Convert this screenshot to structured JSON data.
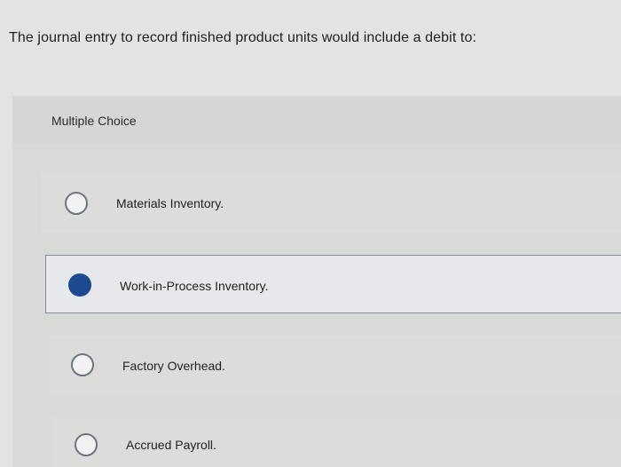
{
  "question": {
    "text": "The journal entry to record finished product units would include a debit to:"
  },
  "multiple_choice": {
    "label": "Multiple Choice",
    "options": [
      {
        "label": "Materials Inventory.",
        "selected": false
      },
      {
        "label": "Work-in-Process Inventory.",
        "selected": true
      },
      {
        "label": "Factory Overhead.",
        "selected": false
      },
      {
        "label": "Accrued Payroll.",
        "selected": false
      }
    ]
  },
  "colors": {
    "selected_radio": "#1c4a8f",
    "selected_border": "#7d8aa0"
  }
}
